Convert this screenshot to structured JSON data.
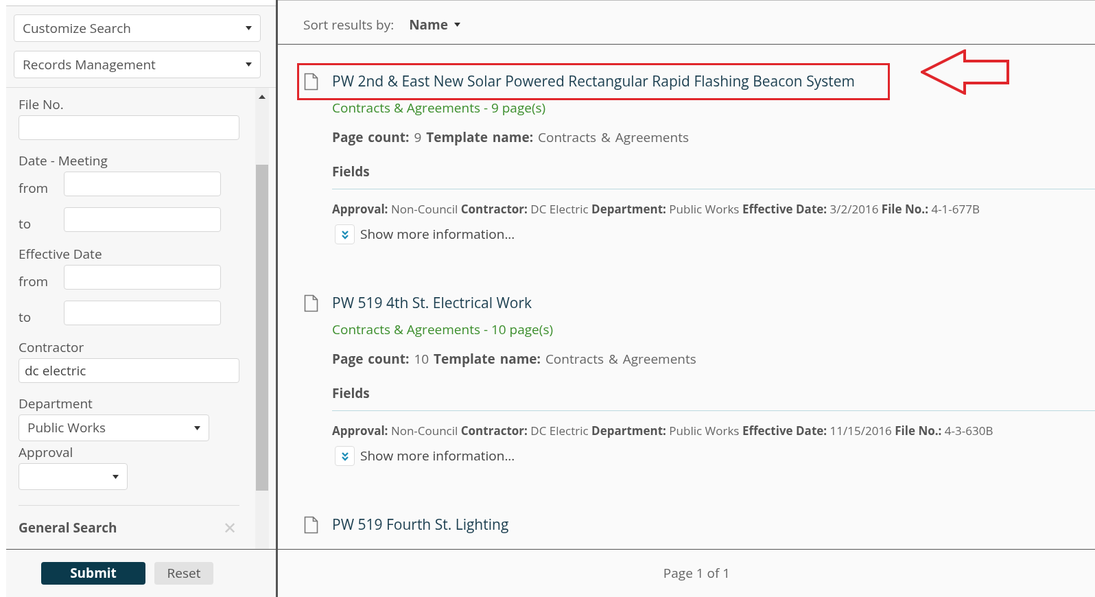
{
  "sidebar": {
    "selects": [
      {
        "value": "Customize Search"
      },
      {
        "value": "Records Management"
      }
    ],
    "fields": [
      {
        "kind": "text",
        "label": "File No."
      },
      {
        "kind": "range",
        "label": "Date - Meeting",
        "from_label": "from",
        "to_label": "to"
      },
      {
        "kind": "range",
        "label": "Effective Date",
        "from_label": "from",
        "to_label": "to"
      },
      {
        "kind": "text",
        "label": "Contractor",
        "value": "dc electric"
      },
      {
        "kind": "dropdown",
        "label": "Department",
        "value": "Public Works"
      },
      {
        "kind": "smalldropdown",
        "label": "Approval"
      }
    ],
    "general_search": {
      "label": "General Search",
      "close": "✕"
    },
    "buttons": [
      {
        "label": "Submit",
        "kind": "primary"
      },
      {
        "label": "Reset",
        "kind": "secondary"
      }
    ]
  },
  "sort": {
    "label": "Sort results by:",
    "value": "Name"
  },
  "results": [
    {
      "title": "PW 2nd & East New Solar Powered Rectangular Rapid Flashing Beacon System",
      "highlighted": true,
      "subtitle": "Contracts & Agreements - 9 page(s)",
      "meta": "**Page count:** 9 **Template name:** Contracts & Agreements",
      "fields_heading": "Fields",
      "fields": "**Approval:** Non-Council **Contractor:** DC Electric **Department:** Public Works **Effective Date:** 3/2/2016 **File No.:** 4-1-677B",
      "more": "Show more information..."
    },
    {
      "title": "PW 519 4th St. Electrical Work",
      "highlighted": false,
      "subtitle": "Contracts & Agreements - 10 page(s)",
      "meta": "**Page count:** 10 **Template name:** Contracts & Agreements",
      "fields_heading": "Fields",
      "fields": "**Approval:** Non-Council **Contractor:** DC Electric **Department:** Public Works **Effective Date:** 11/15/2016 **File No.:** 4-3-630B",
      "more": "Show more information..."
    },
    {
      "title": "PW 519 Fourth St. Lighting",
      "highlighted": false
    }
  ],
  "pagination": "Page 1 of 1"
}
